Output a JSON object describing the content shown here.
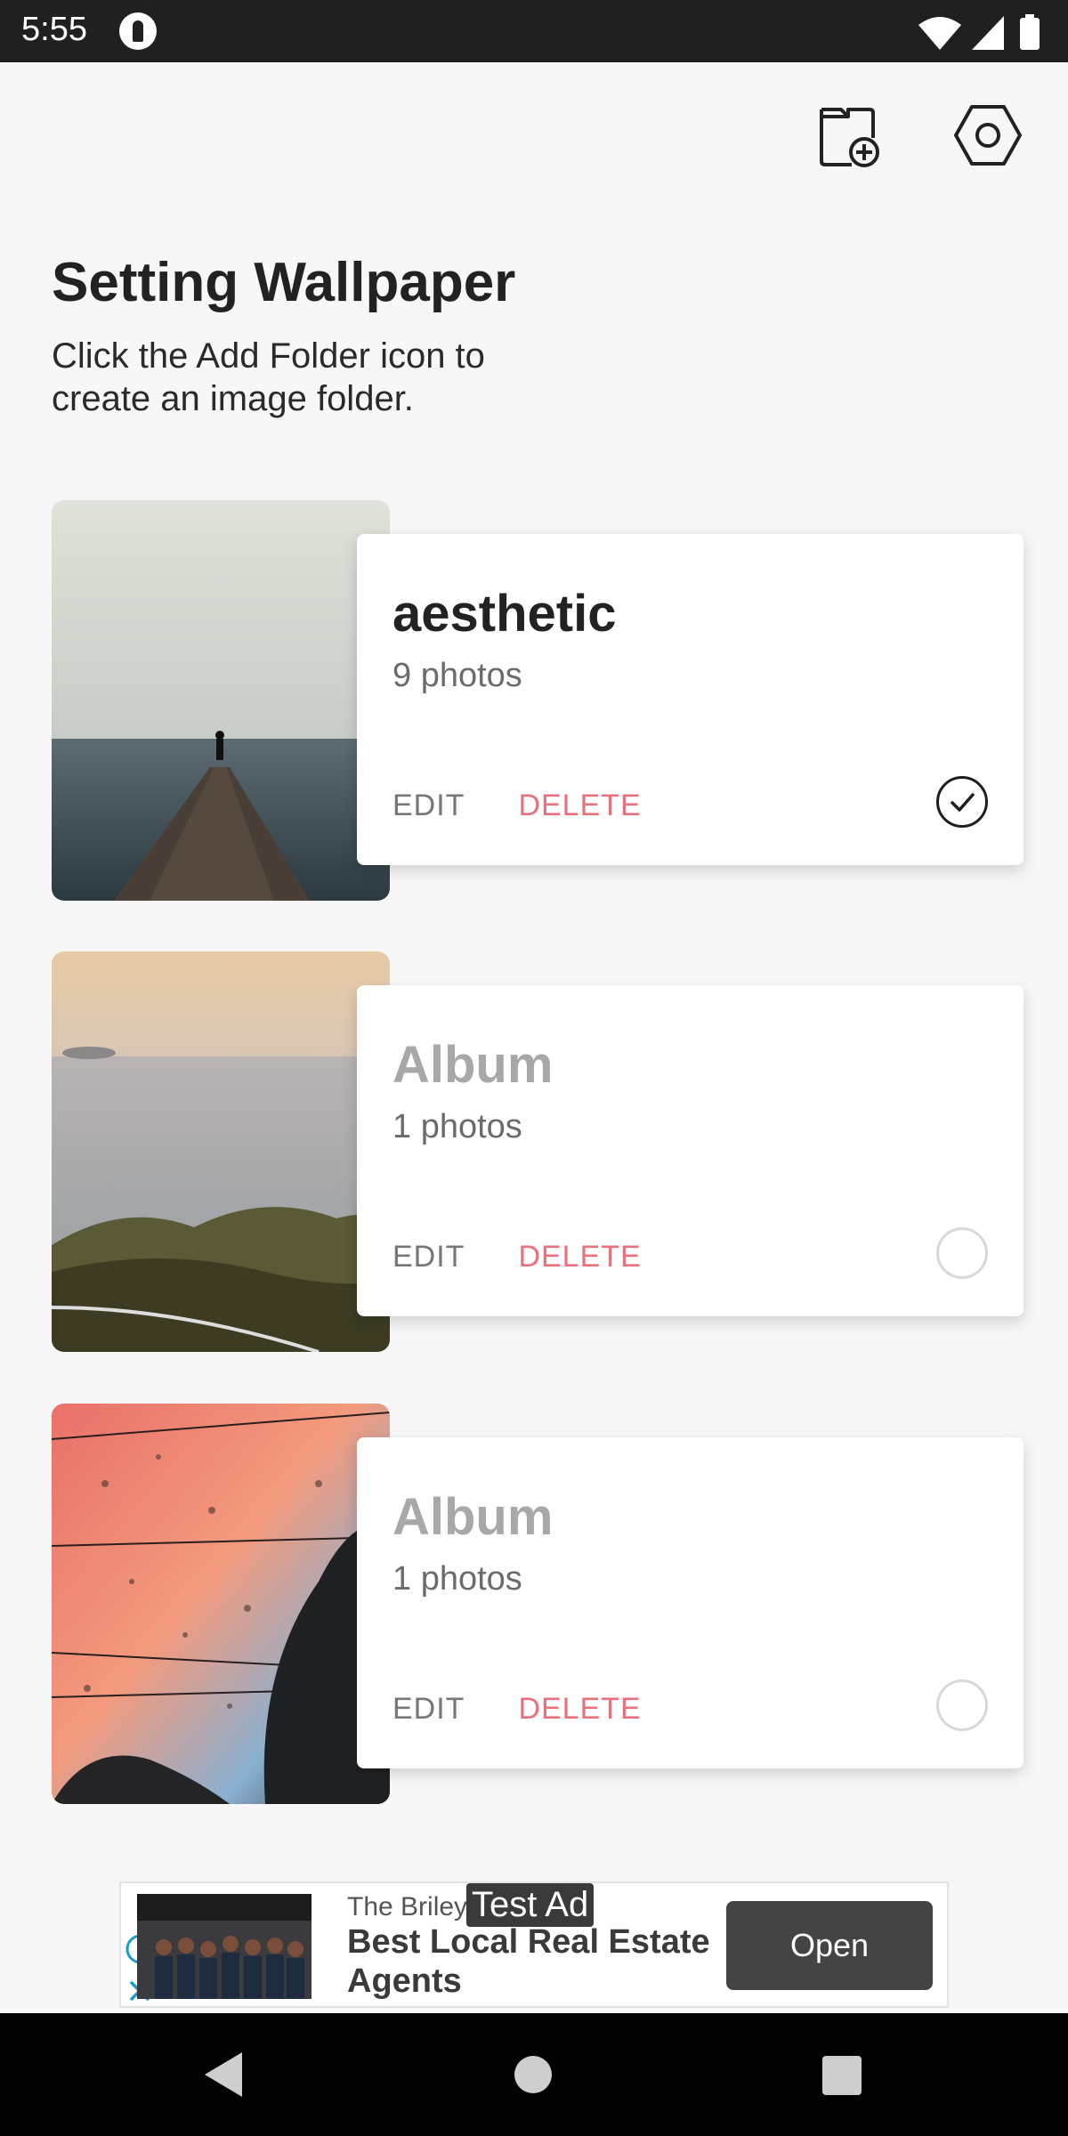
{
  "status_bar": {
    "time": "5:55"
  },
  "header": {
    "title": "Setting Wallpaper",
    "subtitle": "Click the Add Folder icon to create an image folder."
  },
  "folders": [
    {
      "name": "aesthetic",
      "count": "9 photos",
      "edit_label": "EDIT",
      "delete_label": "DELETE",
      "selected": true,
      "name_color": "#222222"
    },
    {
      "name": "Album",
      "count": "1 photos",
      "edit_label": "EDIT",
      "delete_label": "DELETE",
      "selected": false,
      "name_color": "#a8a8a8"
    },
    {
      "name": "Album",
      "count": "1 photos",
      "edit_label": "EDIT",
      "delete_label": "DELETE",
      "selected": false,
      "name_color": "#a8a8a8"
    }
  ],
  "ad": {
    "advertiser": "The Briley",
    "headline": "Best Local Real Estate Agents",
    "test_label": "Test Ad",
    "open_label": "Open"
  },
  "colors": {
    "accent_delete": "#e8717b",
    "background": "#f7f7f7"
  }
}
